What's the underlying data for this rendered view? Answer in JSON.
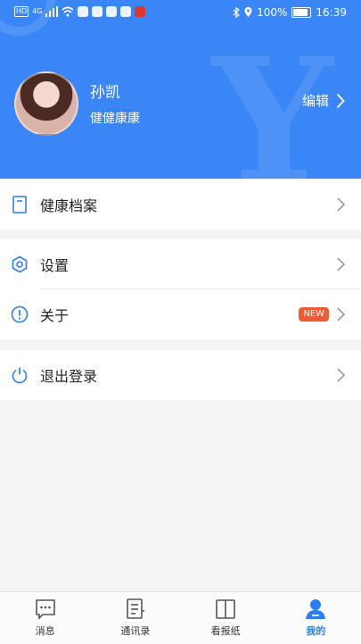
{
  "status_bar": {
    "hd": "HD",
    "network": "4G",
    "battery_percent": "100%",
    "time": "16:39"
  },
  "profile": {
    "name": "孙凯",
    "subtitle": "健健康康",
    "edit_label": "编辑"
  },
  "menu": {
    "health_records": "健康档案",
    "settings": "设置",
    "about": "关于",
    "about_badge": "NEW",
    "logout": "退出登录"
  },
  "tabs": {
    "messages": "消息",
    "contacts": "通讯录",
    "newspaper": "看报纸",
    "mine": "我的"
  },
  "colors": {
    "accent": "#3a86f6",
    "badge": "#ee5a36",
    "active_tab": "#2c7ef0"
  }
}
